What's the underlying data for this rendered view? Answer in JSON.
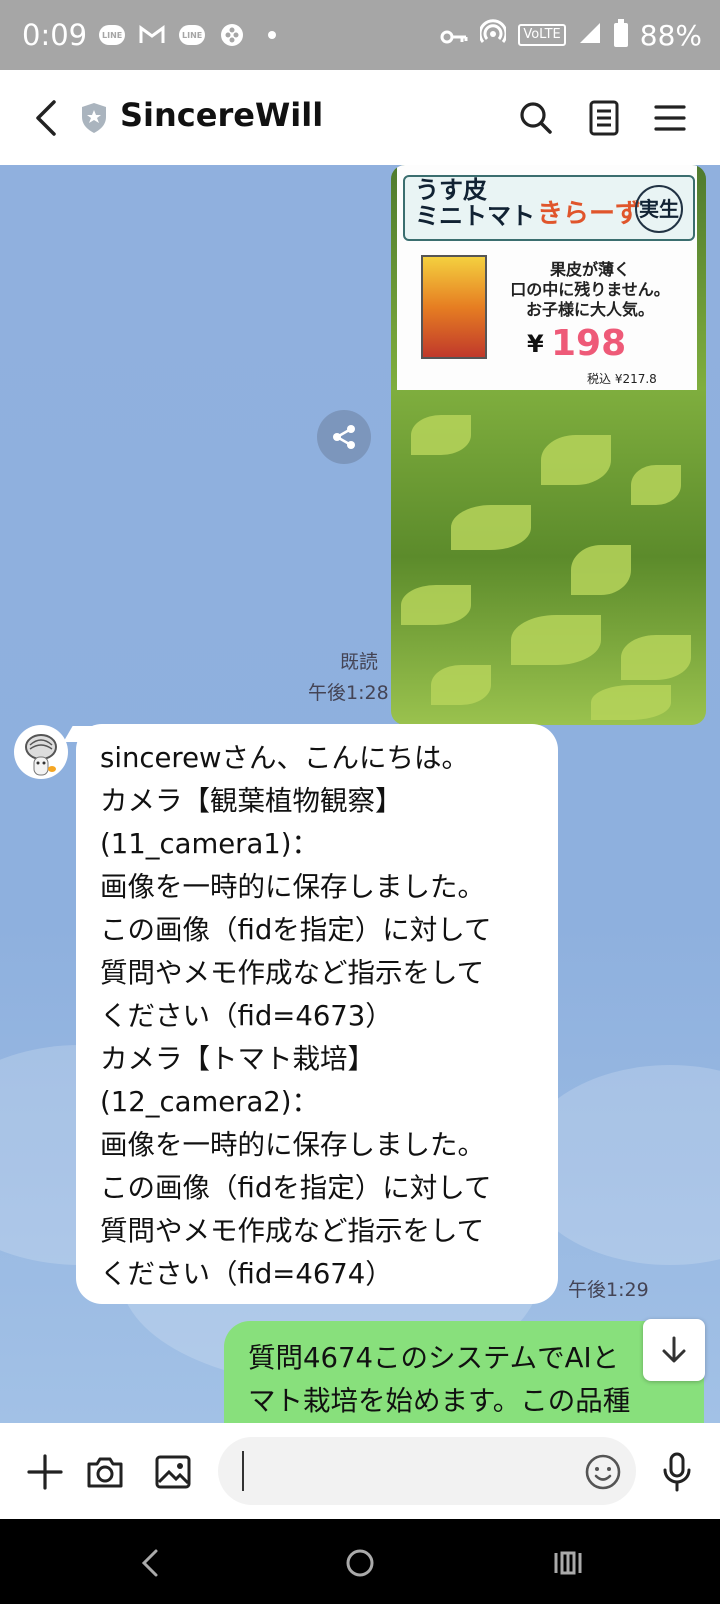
{
  "status_bar": {
    "time": "0:09",
    "battery": "88%",
    "volte": "VoLTE",
    "left_icons": [
      "line-icon",
      "gmail-icon",
      "line-icon",
      "game-icon",
      "dot-icon"
    ],
    "right_icons": [
      "vpn-key-icon",
      "hotspot-icon",
      "volte-icon",
      "signal-icon",
      "battery-icon"
    ]
  },
  "header": {
    "title": "SincereWill"
  },
  "chat": {
    "photo": {
      "sign_line1": "うす皮",
      "sign_line2": "ミニトマト",
      "sign_variety": "きらーず",
      "sign_badge": "実生",
      "sign_desc": "果皮が薄く\n口の中に残りません。\nお子様に大人気。",
      "sign_yen": "¥",
      "sign_price": "198",
      "sign_tax": "税込 ¥217.8"
    },
    "read_label": "既読",
    "time_sent": "午後1:28",
    "bot_message": "sincerewさん、こんにちは。\nカメラ【観葉植物観察】\n(11_camera1)：\n画像を一時的に保存しました。\nこの画像（fidを指定）に対して\n質問やメモ作成など指示をして\nください（fid=4673）\nカメラ【トマト栽培】\n(12_camera2)：\n画像を一時的に保存しました。\nこの画像（fidを指定）に対して\n質問やメモ作成など指示をして\nください（fid=4674）",
    "time_received": "午後1:29",
    "my_message": "質問4674このシステムでAIと\nマト栽培を始めます。この品種"
  },
  "input": {
    "placeholder": ""
  },
  "colors": {
    "chat_bg": "#8fb1dd",
    "my_bubble": "#88e07c",
    "status_bar": "#a6a6a6"
  }
}
